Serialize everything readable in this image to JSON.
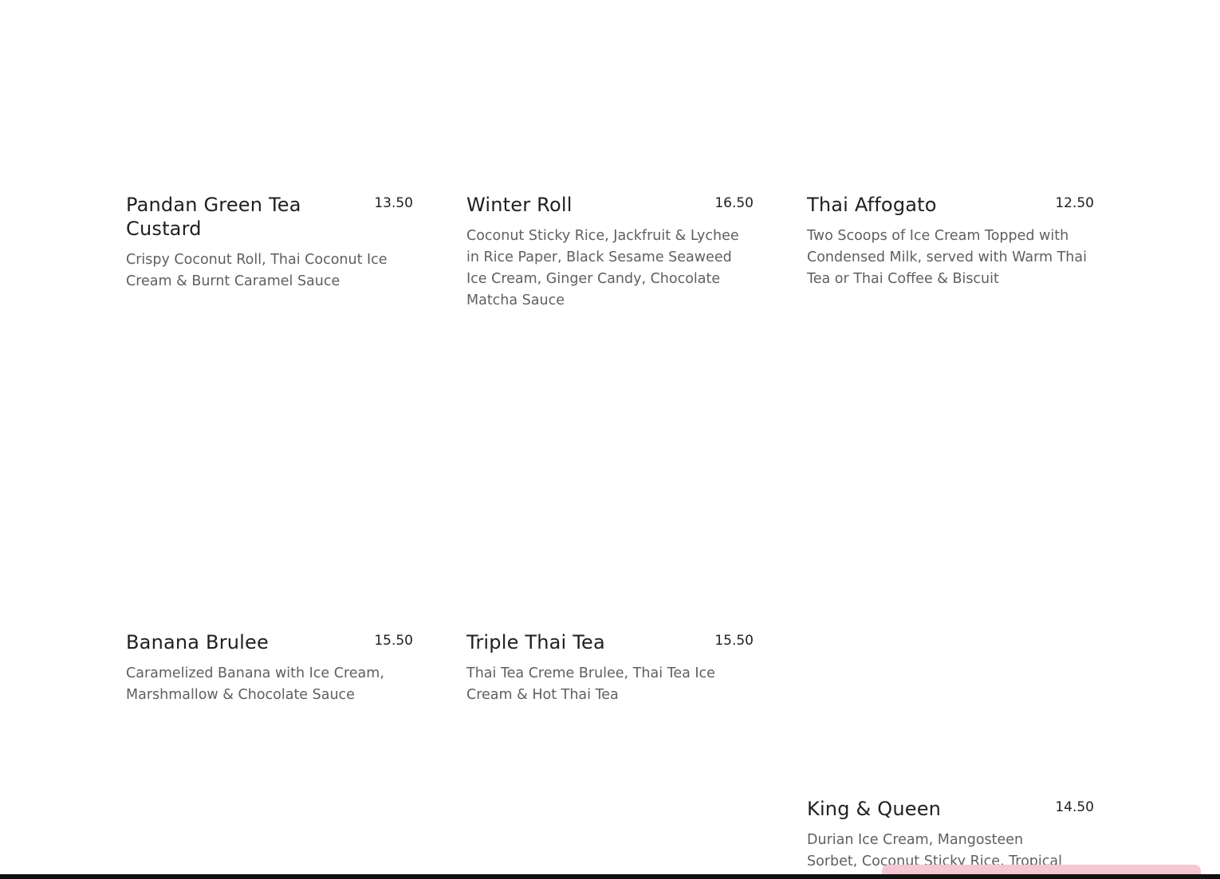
{
  "menu": {
    "items": [
      {
        "name": "Pandan Green Tea Custard",
        "price": "13.50",
        "description": "Crispy Coconut Roll, Thai Coconut Ice Cream & Burnt Caramel Sauce"
      },
      {
        "name": "Winter Roll",
        "price": "16.50",
        "description": "Coconut Sticky Rice, Jackfruit & Lychee in Rice Paper, Black Sesame Seaweed Ice Cream, Ginger Candy, Chocolate Matcha Sauce"
      },
      {
        "name": "Thai Affogato",
        "price": "12.50",
        "description": "Two Scoops of Ice Cream Topped with Condensed Milk, served with Warm Thai Tea or Thai Coffee & Biscuit"
      },
      {
        "name": "Banana Brulee",
        "price": "15.50",
        "description": "Caramelized Banana with Ice Cream, Marshmallow & Chocolate Sauce"
      },
      {
        "name": "Triple Thai Tea",
        "price": "15.50",
        "description": "Thai Tea Creme Brulee, Thai Tea Ice Cream & Hot Thai Tea"
      },
      {
        "name": "King & Queen",
        "price": "14.50",
        "description": "Durian Ice Cream, Mangosteen Sorbet, Coconut Sticky Rice, Tropical"
      }
    ]
  },
  "colors": {
    "title": "#1f1f1f",
    "description": "#5f5f5f",
    "widget": "#f3c7d4"
  }
}
